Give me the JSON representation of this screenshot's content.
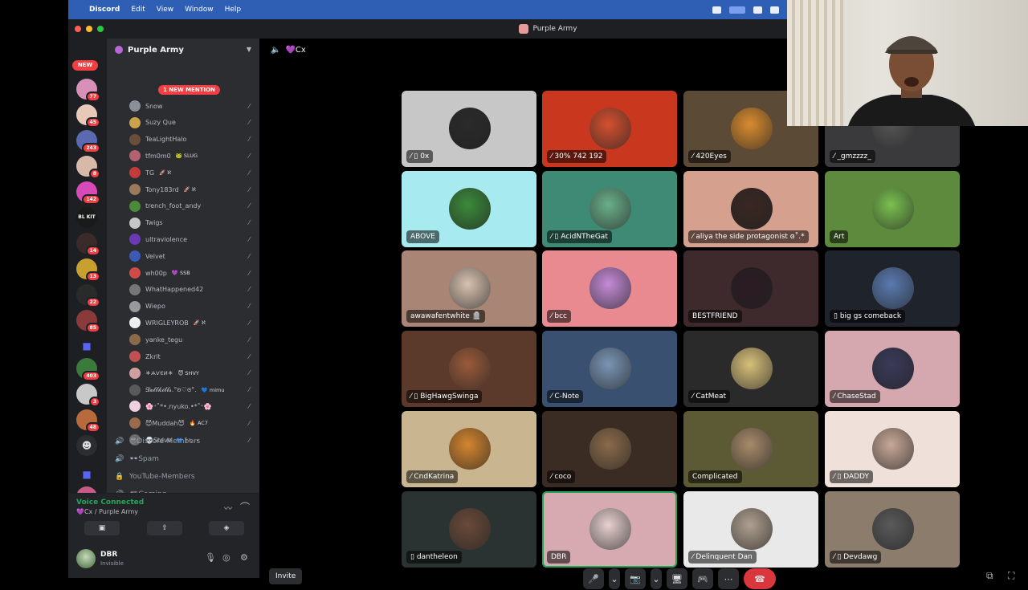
{
  "menubar": {
    "app": "Discord",
    "items": [
      "Edit",
      "View",
      "Window",
      "Help"
    ]
  },
  "window": {
    "title": "Purple Army"
  },
  "server_list": {
    "new_label": "NEW",
    "badges": [
      "77",
      "45",
      "243",
      "8",
      "142",
      "14",
      "13",
      "22",
      "85",
      "403",
      "3",
      "48",
      "1"
    ]
  },
  "server": {
    "name": "Purple Army",
    "mention_label": "1 NEW MENTION",
    "voice_users": [
      {
        "name": "Snow",
        "tag": "",
        "color": "#8a8f98"
      },
      {
        "name": "Suzy Que",
        "tag": "",
        "color": "#c9a24a"
      },
      {
        "name": "TeaLightHalo",
        "tag": "",
        "color": "#6b4d3b"
      },
      {
        "name": "tfm0m0",
        "tag": "🐸 SLUG",
        "color": "#b56070"
      },
      {
        "name": "TG",
        "tag": "🚀 ℵ",
        "color": "#c23b3b"
      },
      {
        "name": "Tony183rd",
        "tag": "🚀 ℵ",
        "color": "#9a7a5a"
      },
      {
        "name": "trench_foot_andy",
        "tag": "",
        "color": "#4a8a3a"
      },
      {
        "name": "Twigs",
        "tag": "",
        "color": "#c7c7c7"
      },
      {
        "name": "ultraviolence",
        "tag": "",
        "color": "#6a3ab5"
      },
      {
        "name": "Velvet",
        "tag": "",
        "color": "#3a5ab5"
      },
      {
        "name": "wh00p",
        "tag": "💜 SSB",
        "color": "#d04a4a"
      },
      {
        "name": "WhatHappened42",
        "tag": "",
        "color": "#777777"
      },
      {
        "name": "Wiepo",
        "tag": "",
        "color": "#999999"
      },
      {
        "name": "WRIGLEYROB",
        "tag": "🚀 ℵ",
        "color": "#eeeeee"
      },
      {
        "name": "yanke_tegu",
        "tag": "",
        "color": "#8a6a4a"
      },
      {
        "name": "Zkrit",
        "tag": "",
        "color": "#c25050"
      },
      {
        "name": "∗ѧѵєи∗",
        "tag": "😈 SHVY",
        "color": "#d0a0a0"
      },
      {
        "name": "𝓓𝓮𝓵𝓵𝓴𝓲𝓵𝓵𝓼.°ʚ♡ɞ°.",
        "tag": "💙 mimu",
        "color": "#5a5a5a"
      },
      {
        "name": "🌸⁺˚*•.nyuko.•*˚⁺🌸",
        "tag": "",
        "color": "#f0d0e0"
      },
      {
        "name": "😈Muddah😈",
        "tag": "🔥 AC7",
        "color": "#9a6a4a"
      },
      {
        "name": "💀Steve",
        "tag": "💙 ꒰ᐢ⸝⸝•",
        "color": "#6a6a6a"
      }
    ],
    "channels": [
      {
        "icon": "🔊",
        "name": "😎Discord-Members"
      },
      {
        "icon": "🔊",
        "name": "👓Spam"
      },
      {
        "icon": "🔒",
        "name": "YouTube-Members"
      },
      {
        "icon": "🔊",
        "name": "🎮Gaming"
      }
    ]
  },
  "voice_panel": {
    "status": "Voice Connected",
    "channel": "💜Cx / Purple Army"
  },
  "user": {
    "name": "DBR",
    "status": "Invisible"
  },
  "stage": {
    "channel": "💜Cx",
    "invite": "Invite",
    "tiles": [
      {
        "name": "0x",
        "bg": "#c7c7c7",
        "pic": "#2a2a2a",
        "muted": true,
        "phone": true
      },
      {
        "name": "30% 742 192",
        "bg": "#c9371f",
        "pic": "#d4502f",
        "muted": true,
        "phone": false
      },
      {
        "name": "420Eyes",
        "bg": "#5b4a35",
        "pic": "#d98c2f",
        "muted": true,
        "phone": false
      },
      {
        "name": "_gmzzzz_",
        "bg": "#3a3a3d",
        "pic": "#555",
        "muted": true,
        "phone": false
      },
      {
        "name": "ABOVE",
        "bg": "#a7eaf0",
        "pic": "#3b8a3b",
        "muted": false,
        "phone": false
      },
      {
        "name": "AcidNTheGat",
        "bg": "#3f8a75",
        "pic": "#6aaf8a",
        "muted": true,
        "phone": true
      },
      {
        "name": "aliya the side protagonist ɞ˚.*",
        "bg": "#d6a08f",
        "pic": "#3a2722",
        "muted": true,
        "phone": false
      },
      {
        "name": "Art",
        "bg": "#5d8a3c",
        "pic": "#7ac04f",
        "muted": false,
        "phone": false
      },
      {
        "name": "awawafentwhite 🪦",
        "bg": "#a88574",
        "pic": "#d8c2b0",
        "muted": false,
        "phone": false
      },
      {
        "name": "bcc",
        "bg": "#e88a8f",
        "pic": "#c58ad6",
        "muted": true,
        "phone": false
      },
      {
        "name": "BESTFRIEND",
        "bg": "#3e2a2c",
        "pic": "#2b1b22",
        "muted": false,
        "phone": false
      },
      {
        "name": "big gs comeback",
        "bg": "#1f232c",
        "pic": "#5a7ab0",
        "muted": false,
        "phone": true
      },
      {
        "name": "BigHawgSwinga",
        "bg": "#5b3a2c",
        "pic": "#9a5a3a",
        "muted": true,
        "phone": true
      },
      {
        "name": "C-Note",
        "bg": "#3a5070",
        "pic": "#7a95b5",
        "muted": true,
        "phone": false
      },
      {
        "name": "CatMeat",
        "bg": "#2a2a2a",
        "pic": "#d8c07a",
        "muted": true,
        "phone": false
      },
      {
        "name": "ChaseStad",
        "bg": "#d4a8ae",
        "pic": "#3a3a5a",
        "muted": true,
        "phone": false
      },
      {
        "name": "CndKatrina",
        "bg": "#c9b58f",
        "pic": "#d4862f",
        "muted": true,
        "phone": false
      },
      {
        "name": "coco",
        "bg": "#3a2c22",
        "pic": "#8a6a4a",
        "muted": true,
        "phone": false
      },
      {
        "name": "Complicated",
        "bg": "#5c5a34",
        "pic": "#a88a6a",
        "muted": false,
        "phone": false
      },
      {
        "name": "DADDY",
        "bg": "#efe0da",
        "pic": "#c8a898",
        "muted": true,
        "phone": true
      },
      {
        "name": "dantheleon",
        "bg": "#2a3332",
        "pic": "#6a4a3a",
        "muted": false,
        "phone": true
      },
      {
        "name": "DBR",
        "bg": "#d7a9b0",
        "pic": "#e8d0d0",
        "muted": false,
        "phone": false,
        "active": true
      },
      {
        "name": "Delinquent Dan",
        "bg": "#e9e9e9",
        "pic": "#b0a090",
        "muted": true,
        "phone": false
      },
      {
        "name": "Devdawg",
        "bg": "#8c7c6c",
        "pic": "#5a5a5a",
        "muted": true,
        "phone": true
      }
    ],
    "controls": [
      "🎤",
      "⌄",
      "📷",
      "⌄",
      "🖥",
      "🎮",
      "⋯",
      "☎"
    ]
  },
  "colors": {
    "accent": "#5865f2",
    "danger": "#da373c",
    "online": "#23a55a",
    "bg": "#1e1f22"
  }
}
